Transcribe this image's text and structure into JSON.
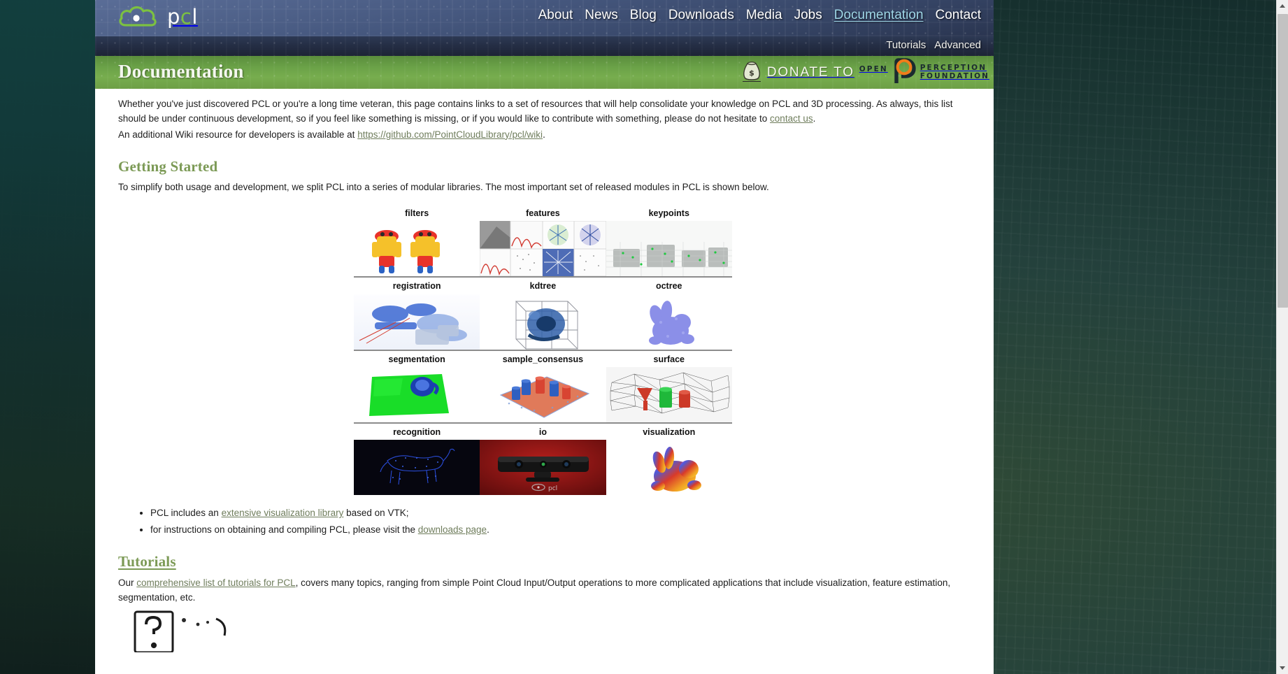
{
  "browser": {
    "scrollbar": {
      "up_arrow": "scroll-up",
      "down_arrow": "scroll-down"
    }
  },
  "site": {
    "logo_text_white": "p",
    "logo_text_green": "c",
    "logo_text_white2": "l",
    "logo_icon": "pcl-cloud-logo"
  },
  "mainnav": {
    "items": [
      {
        "label": "About",
        "active": false
      },
      {
        "label": "News",
        "active": false
      },
      {
        "label": "Blog",
        "active": false
      },
      {
        "label": "Downloads",
        "active": false
      },
      {
        "label": "Media",
        "active": false
      },
      {
        "label": "Jobs",
        "active": false
      },
      {
        "label": "Documentation",
        "active": true
      },
      {
        "label": "Contact",
        "active": false
      }
    ]
  },
  "subnav": {
    "items": [
      {
        "label": "Tutorials"
      },
      {
        "label": "Advanced"
      }
    ]
  },
  "banner": {
    "title": "Documentation",
    "donate": {
      "text": "DONATE TO",
      "org_open": "OPEN",
      "org_line1": "PERCEPTION",
      "org_line2": "FOUNDATION",
      "accent_color": "#f07d1a",
      "bag_icon": "money-bag-icon"
    }
  },
  "intro": {
    "p1_part1": "Whether you've just discovered PCL or you're a long time veteran, this page contains links to a set of resources that will help consolidate your knowledge on PCL and 3D processing. As always, this list should be under continuous development, so if you feel like something is missing, or if you would like to contribute with something, please do not hesitate to ",
    "p1_link": "contact us",
    "p1_part2": ".",
    "p2_part1": "An additional Wiki resource for developers is available at ",
    "p2_link": "https://github.com/PointCloudLibrary/pcl/wiki",
    "p2_part2": "."
  },
  "getting_started": {
    "heading": "Getting Started",
    "paragraph": "To simplify both usage and development, we split PCL into a series of modular libraries. The most important set of released modules in PCL is shown below.",
    "modules": [
      [
        {
          "label": "filters",
          "thumb": "filters-thumbnail"
        },
        {
          "label": "features",
          "thumb": "features-thumbnail"
        },
        {
          "label": "keypoints",
          "thumb": "keypoints-thumbnail"
        }
      ],
      [
        {
          "label": "registration",
          "thumb": "registration-thumbnail"
        },
        {
          "label": "kdtree",
          "thumb": "kdtree-thumbnail"
        },
        {
          "label": "octree",
          "thumb": "octree-thumbnail"
        }
      ],
      [
        {
          "label": "segmentation",
          "thumb": "segmentation-thumbnail"
        },
        {
          "label": "sample_consensus",
          "thumb": "sample-consensus-thumbnail"
        },
        {
          "label": "surface",
          "thumb": "surface-thumbnail"
        }
      ],
      [
        {
          "label": "recognition",
          "thumb": "recognition-thumbnail"
        },
        {
          "label": "io",
          "thumb": "io-thumbnail"
        },
        {
          "label": "visualization",
          "thumb": "visualization-thumbnail"
        }
      ]
    ],
    "bullets": [
      {
        "pre": "PCL includes an ",
        "link": "extensive visualization library",
        "post": " based on VTK;"
      },
      {
        "pre": "for instructions on obtaining and compiling PCL, please visit the ",
        "link": "downloads page",
        "post": "."
      }
    ]
  },
  "tutorials": {
    "heading": "Tutorials",
    "pre": "Our ",
    "link": "comprehensive list of tutorials for PCL",
    "post": ", covers many topics, ranging from simple Point Cloud Input/Output operations to more complicated applications that include visualization, feature estimation, segmentation, etc."
  }
}
